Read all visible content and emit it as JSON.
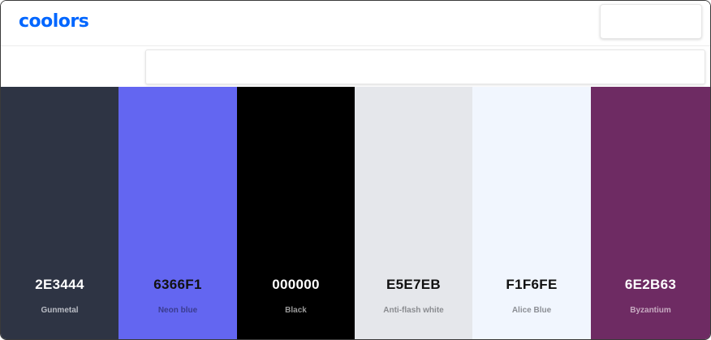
{
  "header": {
    "logo_text": "coolors"
  },
  "palette": [
    {
      "hex": "2E3444",
      "name": "Gunmetal",
      "bg": "#2E3444",
      "hex_color": "#ffffff",
      "name_color": "#b9bcc4"
    },
    {
      "hex": "6366F1",
      "name": "Neon blue",
      "bg": "#6366F1",
      "hex_color": "#111111",
      "name_color": "#3a3c8f"
    },
    {
      "hex": "000000",
      "name": "Black",
      "bg": "#000000",
      "hex_color": "#ffffff",
      "name_color": "#9a9a9a"
    },
    {
      "hex": "E5E7EB",
      "name": "Anti-flash white",
      "bg": "#E5E7EB",
      "hex_color": "#111111",
      "name_color": "#8a8c90"
    },
    {
      "hex": "F1F6FE",
      "name": "Alice Blue",
      "bg": "#F1F6FE",
      "hex_color": "#111111",
      "name_color": "#8c8f95"
    },
    {
      "hex": "6E2B63",
      "name": "Byzantium",
      "bg": "#6E2B63",
      "hex_color": "#ffffff",
      "name_color": "#c7aac1"
    }
  ]
}
